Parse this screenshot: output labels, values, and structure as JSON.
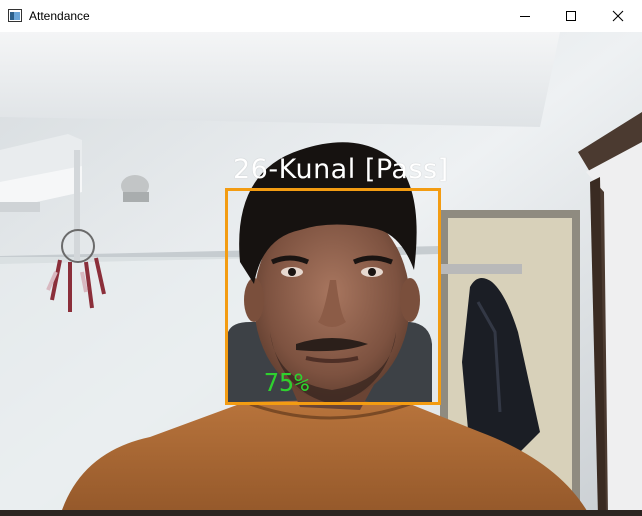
{
  "window": {
    "title": "Attendance",
    "icon": "opencv-window-icon",
    "controls": [
      "minimize-icon",
      "maximize-icon",
      "close-icon"
    ]
  },
  "detection": {
    "label": "26-Kunal [Pass]",
    "confidence": "75%",
    "box_color": "#f39c12",
    "label_color": "#ffffff",
    "confidence_color": "#2fd12f"
  }
}
